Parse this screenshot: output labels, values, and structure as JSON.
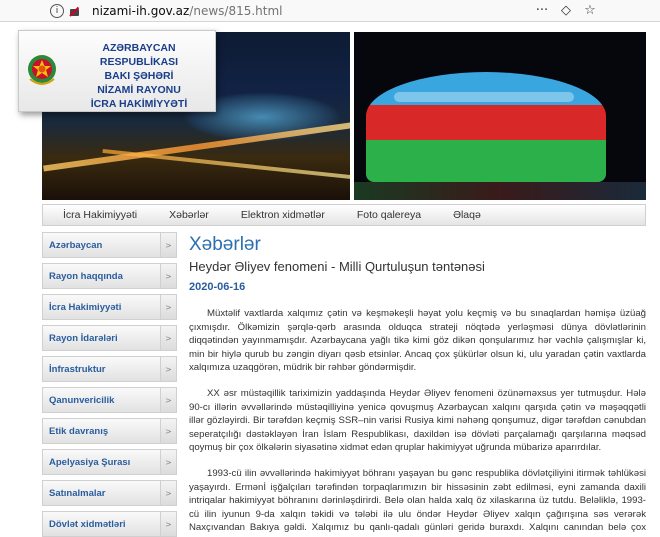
{
  "browser": {
    "url_host": "nizami-ih.gov.az",
    "url_path": "/news/815.html",
    "icons": [
      "more-icon",
      "pocket-icon",
      "bookmark-star-icon"
    ]
  },
  "header": {
    "title_lines": [
      "AZƏRBAYCAN RESPUBLİKASI",
      "BAKI ŞƏHƏRİ",
      "NİZAMİ RAYONU",
      "İCRA HAKİMİYYƏTİ"
    ]
  },
  "topnav": {
    "items": [
      "İcra Hakimiyyəti",
      "Xəbərlər",
      "Elektron xidmətlər",
      "Foto qalereya",
      "Əlaqə"
    ]
  },
  "sidebar": {
    "items": [
      "Azərbaycan",
      "Rayon haqqında",
      "İcra Hakimiyyəti",
      "Rayon İdarələri",
      "İnfrastruktur",
      "Qanunvericilik",
      "Etik davranış",
      "Apelyasiya Şurası",
      "Satınalmalar",
      "Dövlət xidmətləri"
    ]
  },
  "article": {
    "section_title": "Xəbərlər",
    "headline": "Heydər Əliyev fenomeni - Milli Qurtuluşun təntənəsi",
    "date": "2020-06-16",
    "paragraphs": [
      "Müxtəlif vaxtlarda xalqımız çətin və keşməkeşli həyat yolu keçmiş və bu sınaqlardan həmişə üzüağ çıxmışdır. Ölkəmizin şərqlə-qərb arasında olduqca strateji nöqtədə yerləşməsi dünya dövlətlərinin diqqətindən yayınmamışdır. Azərbaycana yağlı tikə kimi göz dikən qonşularımız hər vəchlə çalışmışlar ki, min bir hiylə qurub bu zəngin diyarı qəsb etsinlər. Ancaq çox şükürlər olsun ki, ulu yaradan çətin vaxtlarda xalqımıza uzaqgörən, müdrik bir rəhbər göndərmişdir.",
      "XX əsr müstəqillik tariximizin yaddaşında Heydər Əliyev fenomeni özünəməxsus yer tutmuşdur. Hələ 90-cı illərin əvvəllərində müstəqilliyinə yenicə qovuşmuş Azərbaycan xalqını qarşıda çətin və məşəqqətli illər gözləyirdi. Bir tərəfdən keçmiş SSR–nin varisi Rusiya kimi nəhəng qonşumuz, digər tərəfdən cənubdan seperatçılığı dəstəkləyən İran İslam Respublikası, daxildən isə dövləti parçalamağı qarşılarına məqsəd qoymuş bir çox ölkələrin siyasətinə xidmət edən qruplar hakimiyyət uğrunda mübarizə aparırdılar.",
      "1993-cü ilin əvvəllərində hakimiyyət böhranı yaşayan bu gənc respublika dövlətçiliyini itirmək təhlükəsi yaşayırdı. Ermənİ işğalçıları tərəfindən torpaqlarımızın bir hissəsinin zəbt edilməsi, eyni zamanda daxili intriqalar hakimiyyət böhranını dərinləşdirirdi. Belə olan halda xalq öz xilaskarına üz tutdu. Beləliklə, 1993-cü ilin iyunun 9-da xalqın təkidi və tələbi ilə ulu öndər Heydər Əliyev xalqın çağırışına səs verərək Naxçıvandan Bakıya gəldi. Xalqımız bu qanlı-qadalı günləri geridə buraxdı. Xalqını canından belə çox sevən bu müdrik"
    ]
  }
}
